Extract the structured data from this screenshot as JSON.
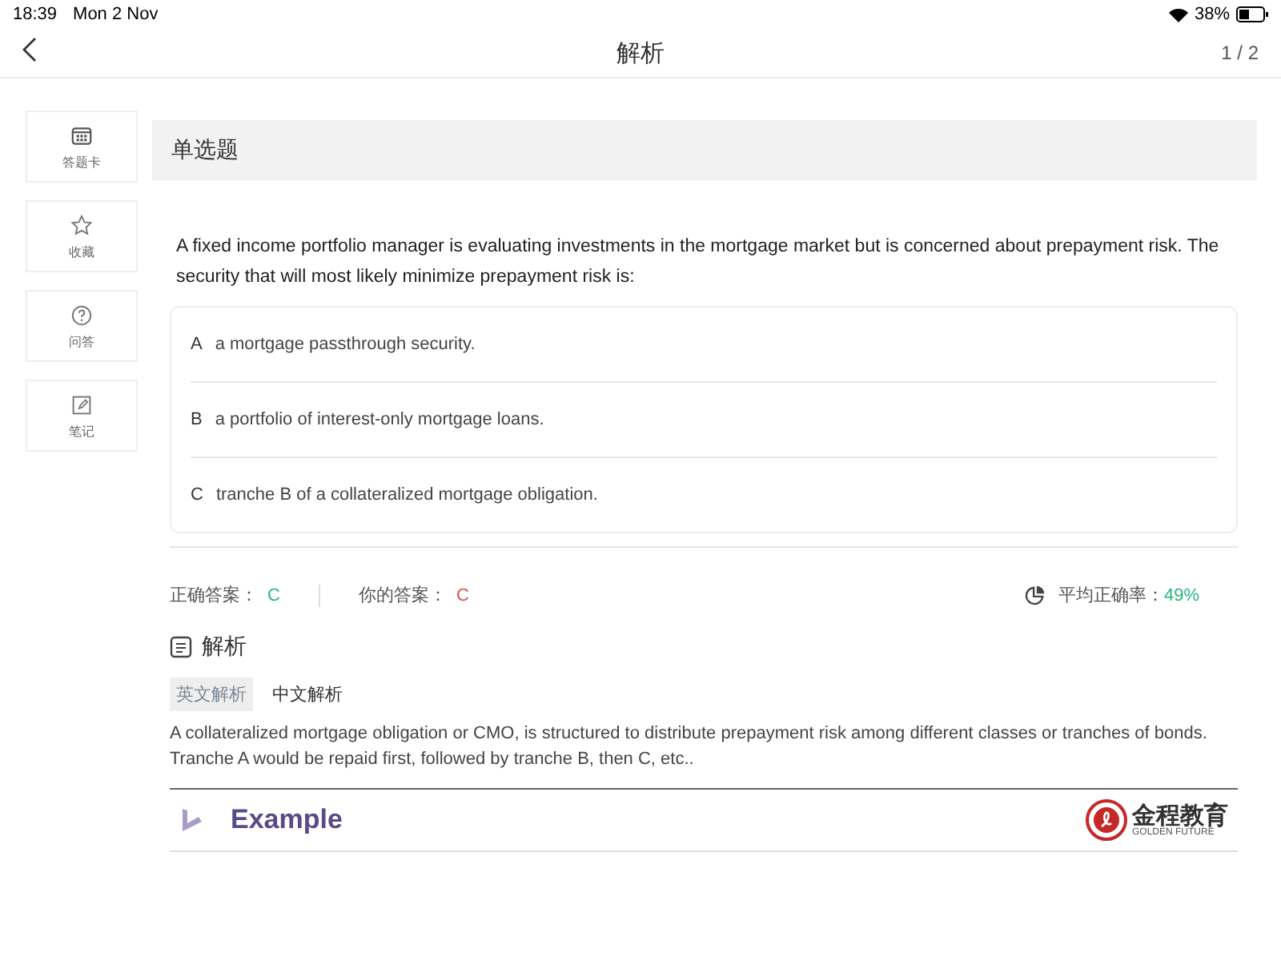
{
  "status_bar": {
    "time": "18:39",
    "date": "Mon 2 Nov",
    "battery": "38%"
  },
  "header": {
    "title": "解析",
    "page": "1 / 2"
  },
  "sidebar": {
    "items": [
      {
        "label": "答题卡",
        "kind": "card"
      },
      {
        "label": "收藏",
        "kind": "star"
      },
      {
        "label": "问答",
        "kind": "question"
      },
      {
        "label": "笔记",
        "kind": "note"
      }
    ]
  },
  "question": {
    "type": "单选题",
    "text": "A fixed income portfolio manager is evaluating investments in the mortgage market but is concerned about prepayment risk. The security that will most likely minimize prepayment risk is:",
    "options": [
      {
        "letter": "A",
        "text": "a mortgage passthrough security."
      },
      {
        "letter": "B",
        "text": "a portfolio of interest-only mortgage loans."
      },
      {
        "letter": "C",
        "text": "tranche B of a collateralized mortgage obligation."
      }
    ]
  },
  "answers": {
    "correct_label": "正确答案：",
    "correct": "C",
    "yours_label": "你的答案：",
    "yours": "C",
    "average_label": "平均正确率：",
    "average": "49%"
  },
  "analysis": {
    "title": "解析",
    "tabs": [
      {
        "label": "英文解析",
        "selected": true
      },
      {
        "label": "中文解析",
        "selected": false
      }
    ],
    "text": "A collateralized mortgage obligation or CMO, is structured to distribute prepayment risk among different classes or tranches of bonds. Tranche A would be repaid first, followed by tranche B, then C, etc..",
    "slide": {
      "title": "Example",
      "logo_cn": "金程教育",
      "logo_en": "GOLDEN FUTURE"
    }
  }
}
